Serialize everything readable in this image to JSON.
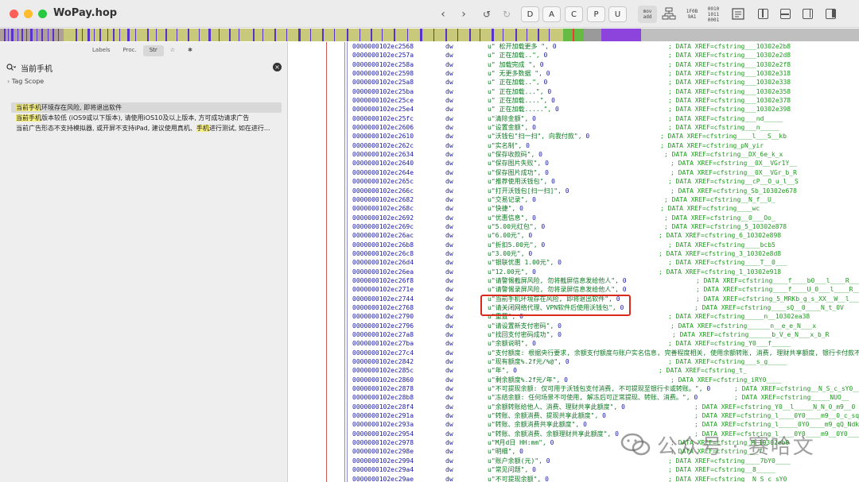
{
  "app": {
    "title": "WoPay.hop"
  },
  "toolbar": {
    "letters": [
      "D",
      "A",
      "C",
      "P",
      "U"
    ],
    "mini_mov_add": [
      "mov",
      "add"
    ],
    "mini_hex": [
      "1F0B",
      "9A1"
    ],
    "mini_bin": [
      "0010",
      "1011",
      "0001"
    ]
  },
  "sidebar": {
    "tabs": [
      "Labels",
      "Proc.",
      "Str",
      "☆",
      "✱"
    ],
    "active_tab": "Str",
    "search_value": "当前手机",
    "tag_scope": "Tag Scope",
    "results": [
      {
        "highlight": "当前手机",
        "rest": "环境存在风险, 即将退出软件",
        "selected": true
      },
      {
        "highlight": "当前手机",
        "rest": "版本较低 (iOS9或以下版本), 请使用iOS10及以上版本, 方可成功请求广告",
        "selected": false
      },
      {
        "pre": "当前广告形态不支持模拟器, 或开屏不支持iPad, 建议使用真机、",
        "highlight": "手机",
        "rest": "进行测试, 如在进行...",
        "selected": false
      }
    ]
  },
  "code": {
    "rows": [
      {
        "addr": "0000000102ec2568",
        "op": "dw",
        "val": "u\" 松开加载更多 \"",
        "num": "0",
        "xref": "; DATA XREF=cfstring___10302e2b8"
      },
      {
        "addr": "0000000102ec257a",
        "op": "dw",
        "val": "u\"  正在加载..\"",
        "num": "0",
        "xref": "; DATA XREF=cfstring___10302e2d8"
      },
      {
        "addr": "0000000102ec258a",
        "op": "dw",
        "val": "u\" 加载完成 \"",
        "num": "0",
        "xref": "; DATA XREF=cfstring___10302e2f8"
      },
      {
        "addr": "0000000102ec2598",
        "op": "dw",
        "val": "u\" 无更多数据 \"",
        "num": "0",
        "xref": "; DATA XREF=cfstring___10302e318"
      },
      {
        "addr": "0000000102ec25a8",
        "op": "dw",
        "val": "u\"  正在加载..\"",
        "num": "0",
        "xref": "; DATA XREF=cfstring___10302e338"
      },
      {
        "addr": "0000000102ec25ba",
        "op": "dw",
        "val": "u\"  正在加载...\"",
        "num": "0",
        "xref": "; DATA XREF=cfstring___10302e358"
      },
      {
        "addr": "0000000102ec25ce",
        "op": "dw",
        "val": "u\"  正在加载....\"",
        "num": "0",
        "xref": "; DATA XREF=cfstring___10302e378"
      },
      {
        "addr": "0000000102ec25e4",
        "op": "dw",
        "val": "u\"  正在加载.....\"",
        "num": "0",
        "xref": "; DATA XREF=cfstring___10302e398"
      },
      {
        "addr": "0000000102ec25fc",
        "op": "dw",
        "val": "u\"清除金额\"",
        "num": "0",
        "xref": "; DATA XREF=cfstring___nd_____"
      },
      {
        "addr": "0000000102ec2606",
        "op": "dw",
        "val": "u\"设置金额\"",
        "num": "0",
        "xref": "; DATA XREF=cfstring___n_____"
      },
      {
        "addr": "0000000102ec2610",
        "op": "dw",
        "val": "u\"沃钱包\"扫一扫\", 向我付款\"",
        "num": "0",
        "xref": "; DATA XREF=cfstring____l___S__kb"
      },
      {
        "addr": "0000000102ec262c",
        "op": "dw",
        "val": "u\"实名制\"",
        "num": "0",
        "xref": "; DATA XREF=cfstring_pN_yir"
      },
      {
        "addr": "0000000102ec2634",
        "op": "dw",
        "val": "u\"保存收款码\"",
        "num": "0",
        "xref": "; DATA XREF=cfstring__DX_6e_k_x"
      },
      {
        "addr": "0000000102ec2640",
        "op": "dw",
        "val": "u\"保存图片失败\"",
        "num": "0",
        "xref": "; DATA XREF=cfstring__0X__VGr1Y__"
      },
      {
        "addr": "0000000102ec264e",
        "op": "dw",
        "val": "u\"保存图片成功\"",
        "num": "0",
        "xref": "; DATA XREF=cfstring__0X__VGr_b_R"
      },
      {
        "addr": "0000000102ec265c",
        "op": "dw",
        "val": "u\"推荐使用沃钱包\"",
        "num": "0",
        "xref": "; DATA XREF=cfstring__cP__O_u_l__S"
      },
      {
        "addr": "0000000102ec266c",
        "op": "dw",
        "val": "u\"打开沃钱包[扫一扫]\"",
        "num": "0",
        "xref": "; DATA XREF=cfstring_Sb_10302e678"
      },
      {
        "addr": "0000000102ec2682",
        "op": "dw",
        "val": "u\"交易记录\"",
        "num": "0",
        "xref": "; DATA XREF=cfstring__N_f__U_"
      },
      {
        "addr": "0000000102ec268c",
        "op": "dw",
        "val": "u\"快捷\"",
        "num": "0",
        "xref": "; DATA XREF=cfstring____wc"
      },
      {
        "addr": "0000000102ec2692",
        "op": "dw",
        "val": "u\"优惠信息\"",
        "num": "0",
        "xref": "; DATA XREF=cfstring__0___Oo_"
      },
      {
        "addr": "0000000102ec269c",
        "op": "dw",
        "val": "u\"5.00元红包\"",
        "num": "0",
        "xref": "; DATA XREF=cfstring_5_10302e878"
      },
      {
        "addr": "0000000102ec26ac",
        "op": "dw",
        "val": "u\"6.00元\"",
        "num": "0",
        "xref": "; DATA XREF=cfstring_6_10302e898"
      },
      {
        "addr": "0000000102ec26b8",
        "op": "dw",
        "val": "u\"折扣5.00元\"",
        "num": "0",
        "xref": "; DATA XREF=cfstring____bcb5"
      },
      {
        "addr": "0000000102ec26c8",
        "op": "dw",
        "val": "u\"3.00元\"",
        "num": "0",
        "xref": "; DATA XREF=cfstring_3_10302e8d8"
      },
      {
        "addr": "0000000102ec26d4",
        "op": "dw",
        "val": "u\"银联优惠 1.00元\"",
        "num": "0",
        "xref": "; DATA XREF=cfstring____T__0___"
      },
      {
        "addr": "0000000102ec26ea",
        "op": "dw",
        "val": "u\"12.00元\"",
        "num": "0",
        "xref": "; DATA XREF=cfstring_1_10302e918"
      },
      {
        "addr": "0000000102ec26f8",
        "op": "dw",
        "val": "u\"请警惕截屏风险, 勿将截屏信息发给他人\"",
        "num": "0",
        "xref": "; DATA XREF=cfstring____f____b0___l____R___b"
      },
      {
        "addr": "0000000102ec271e",
        "op": "dw",
        "val": "u\"请警惕录屏风险, 勿将录屏信息发给他人\"",
        "num": "0",
        "xref": "; DATA XREF=cfstring____f____U_0___l____R___U_"
      },
      {
        "addr": "0000000102ec2744",
        "op": "dw",
        "val": "u\"当前手机环境存在风险, 即将退出软件\"",
        "num": "0",
        "xref": "; DATA XREF=cfstring_5_MRKb_g_s_XX__W__l___s"
      },
      {
        "addr": "0000000102ec2768",
        "op": "dw",
        "val": "u\"请关闭网络代理、VPN软件后使用沃钱包\"",
        "num": "0",
        "xref": "; DATA XREF=cfstring____sQ__0____N_t_0V"
      },
      {
        "addr": "0000000102ec2790",
        "op": "dw",
        "val": "u\"重置\"",
        "num": "0",
        "xref": "; DATA XREF=cfstring_____n__10302ea38"
      },
      {
        "addr": "0000000102ec2796",
        "op": "dw",
        "val": "u\"请设置新支付密码\"",
        "num": "0",
        "xref": "; DATA XREF=cfstring______n__e_e_N___x"
      },
      {
        "addr": "0000000102ec27a8",
        "op": "dw",
        "val": "u\"找回支付密码成功\"",
        "num": "0",
        "xref": "; DATA XREF=cfstring______b_V_e_N___x_b_R"
      },
      {
        "addr": "0000000102ec27ba",
        "op": "dw",
        "val": "u\"余额说明\"",
        "num": "0",
        "xref": "; DATA XREF=cfstring_Y0___f_____"
      },
      {
        "addr": "0000000102ec27c4",
        "op": "dw",
        "val": "u\"支付额度: 根据央行要求, 余额支付额度与账户实名信息, 完善程度相关, 使用余额转账, 消费, 理财共享额度, 银行卡付款不受该额度限制。\"",
        "num": "0",
        "xref": ""
      },
      {
        "addr": "0000000102ec2842",
        "op": "dw",
        "val": "u\"现有额度%.2f元/%@\"",
        "num": "0",
        "xref": "; DATA XREF=cfstring___s_g_____"
      },
      {
        "addr": "0000000102ec285c",
        "op": "dw",
        "val": "u\"年\"",
        "num": "0",
        "xref": "; DATA XREF=cfstring_t_"
      },
      {
        "addr": "0000000102ec2860",
        "op": "dw",
        "val": "u\"剩余额度%.2f元/年\"",
        "num": "0",
        "xref": "; DATA XREF=cfstring_iRY0____"
      },
      {
        "addr": "0000000102ec2878",
        "op": "dw",
        "val": "u\"不可提现余额: 仅可用于沃钱包支付消费, 不可提现至银行卡或转账。\"",
        "num": "0",
        "xref": "; DATA XREF=cfstring__N_S_c_sY0_____"
      },
      {
        "addr": "0000000102ec28b8",
        "op": "dw",
        "val": "u\"冻结余额: 任何场景不可使用, 解冻后可正常提现、转账、消费。\"",
        "num": "0",
        "xref": "; DATA XREF=cfstring_____NUO__"
      },
      {
        "addr": "0000000102ec28f4",
        "op": "dw",
        "val": "u\"余额转账给他人、消费、理财共享此额度\"",
        "num": "0",
        "xref": "; DATA XREF=cfstring_Y0__l_____N_N_0_m9__0"
      },
      {
        "addr": "0000000102ec291a",
        "op": "dw",
        "val": "u\"转账、余额消费、提现共享此额度\"",
        "num": "0",
        "xref": "; DATA XREF=cfstring_l____0Y0____m9__0_c_sqQ_N"
      },
      {
        "addr": "0000000102ec293a",
        "op": "dw",
        "val": "u\"转账、余额消费共享此额度\"",
        "num": "0",
        "xref": "; DATA XREF=cfstring_l_____0Y0____m9_qQ_Ndk___"
      },
      {
        "addr": "0000000102ec2954",
        "op": "dw",
        "val": "u\"转账、余额消费、余额理财共享此额度\"",
        "num": "0",
        "xref": "; DATA XREF=cfstring_l____0Y0____m9__0Y0____t_"
      },
      {
        "addr": "0000000102ec2978",
        "op": "dw",
        "val": "u\"M月d日 HH:mm\"",
        "num": "0",
        "xref": "; DATA XREF=cfstring_M_10302eb9"
      },
      {
        "addr": "0000000102ec298e",
        "op": "dw",
        "val": "u\"明细\"",
        "num": "0",
        "xref": "; DATA XREF=cfstring___f"
      },
      {
        "addr": "0000000102ec2994",
        "op": "dw",
        "val": "u\"账户余额(元)\"",
        "num": "0",
        "xref": "; DATA XREF=cfstring____7bY0____"
      },
      {
        "addr": "0000000102ec29a4",
        "op": "dw",
        "val": "u\"常见问题\"",
        "num": "0",
        "xref": "; DATA XREF=cfstring__8_____"
      },
      {
        "addr": "0000000102ec29ae",
        "op": "dw",
        "val": "u\"不可提现余额\"",
        "num": "0",
        "xref": "; DATA XREF=cfstring__N_S_c_sY0_"
      }
    ]
  },
  "watermark": {
    "text": "公众号 · 赛哈文"
  },
  "colors": {
    "addr": "#1a1aa6",
    "string": "#0b7a20",
    "xref": "#1f9a1f",
    "highlight": "#f5ef80",
    "redbox": "#d92a1c"
  }
}
